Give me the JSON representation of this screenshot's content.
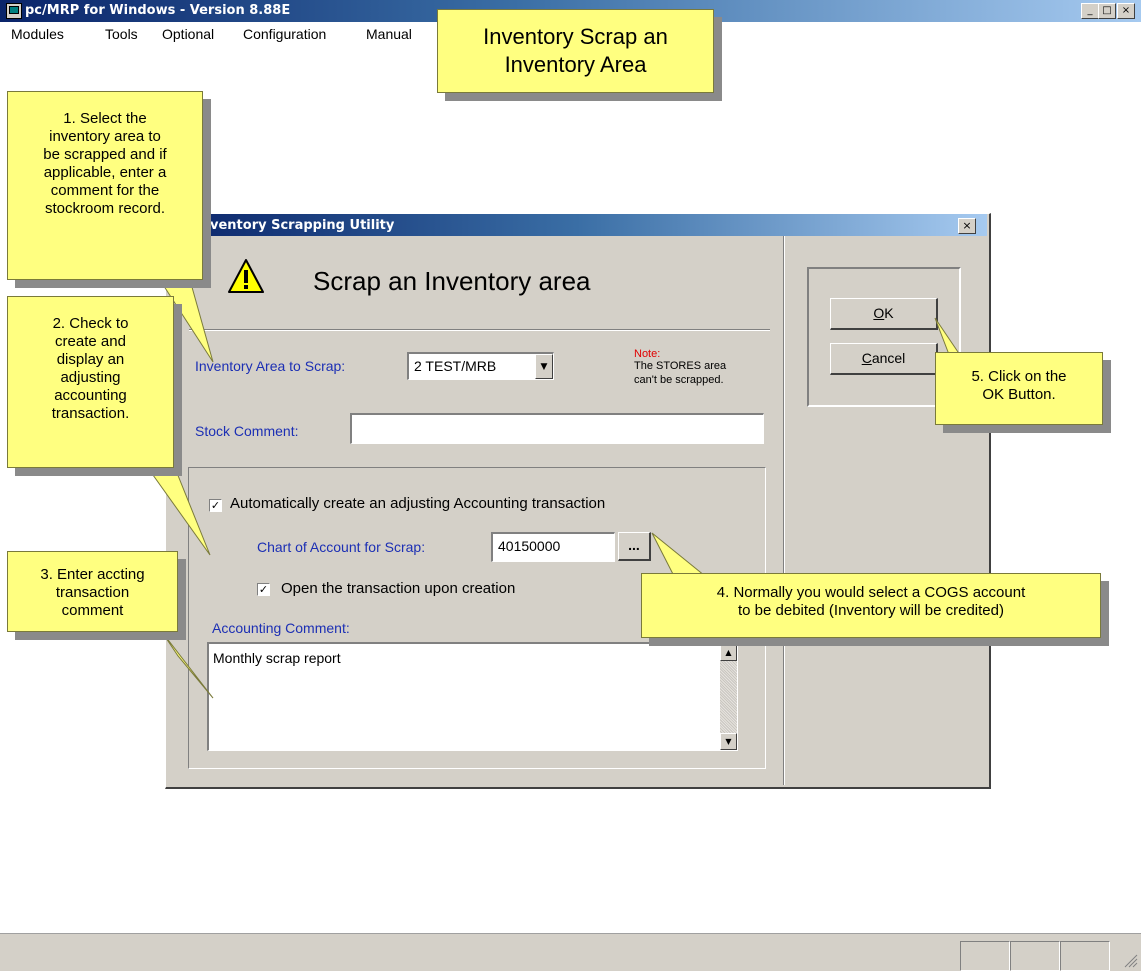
{
  "app": {
    "title": "pc/MRP for Windows - Version 8.88E",
    "window_buttons": [
      "_",
      "□",
      "×"
    ]
  },
  "menu": [
    "Modules",
    "Tools",
    "Optional",
    "Configuration",
    "Manual"
  ],
  "dialog": {
    "title": "ventory Scrapping Utility",
    "close": "×",
    "heading": "Scrap an Inventory area",
    "inventory_area_label": "Inventory Area to Scrap:",
    "inventory_area_value": "2  TEST/MRB",
    "note_label": "Note:",
    "note_lines": [
      "The STORES area",
      "can't be scrapped."
    ],
    "stock_comment_label": "Stock Comment:",
    "stock_comment_value": "",
    "auto_create_label": "Automatically create an adjusting Accounting transaction",
    "auto_create_checked": true,
    "chart_account_label": "Chart of Account for Scrap:",
    "chart_account_value": "40150000",
    "browse_label": "...",
    "open_transaction_label": "Open the transaction upon creation",
    "open_transaction_checked": true,
    "accounting_comment_label": "Accounting Comment:",
    "accounting_comment_value": "Monthly scrap report",
    "ok_mnemonic": "O",
    "ok_rest": "K",
    "cancel_mnemonic": "C",
    "cancel_rest": "ancel"
  },
  "callouts": {
    "title": [
      "Inventory Scrap an",
      "Inventory Area"
    ],
    "step1": [
      "1. Select the",
      "inventory area to",
      "be scrapped and if",
      "applicable, enter a",
      "comment for the",
      "stockroom record."
    ],
    "step2": [
      "2. Check to",
      "create and",
      "display an",
      "adjusting",
      "accounting",
      "transaction."
    ],
    "step3": [
      "3. Enter accting",
      "transaction",
      "comment"
    ],
    "step4": [
      "4. Normally you would select a COGS account",
      "to be debited (Inventory will be credited)"
    ],
    "step5": [
      "5. Click on the",
      "OK Button."
    ]
  },
  "colors": {
    "callout_bg": "#ffff80",
    "label_blue": "#1c2fb4",
    "note_red": "#e00000",
    "dialog_bg": "#d4d0c8"
  }
}
